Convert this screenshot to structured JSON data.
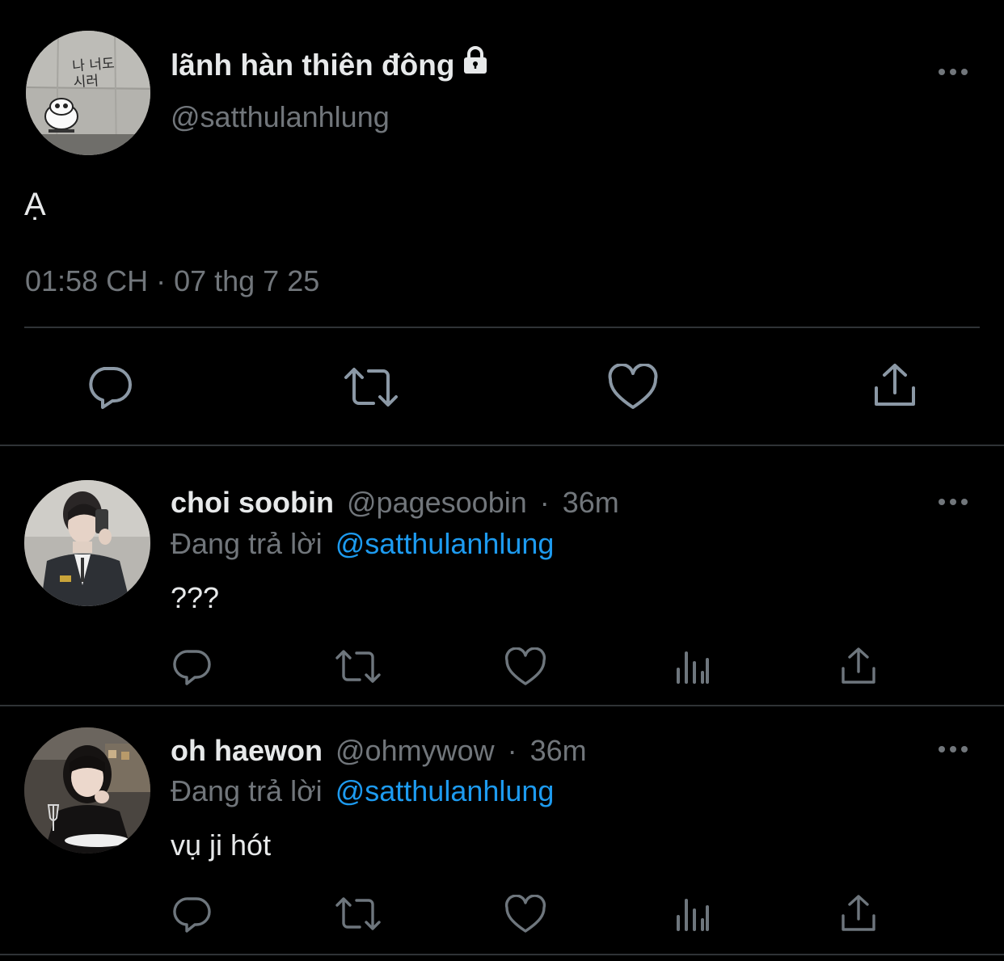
{
  "main_tweet": {
    "display_name": "lãnh hàn thiên đông",
    "handle": "@satthulanhlung",
    "text": "Ạ",
    "timestamp": "01:58 CH · 07 thg 7 25",
    "avatar_graffiti": "나 너도 시러",
    "icons": [
      "reply-icon",
      "retweet-icon",
      "like-icon",
      "share-icon"
    ]
  },
  "replies": [
    {
      "display_name": "choi soobin",
      "handle": "@pagesoobin",
      "dot": "·",
      "time": "36m",
      "replying_prefix": "Đang trả lời",
      "replying_to": "@satthulanhlung",
      "text": "???"
    },
    {
      "display_name": "oh haewon",
      "handle": "@ohmywow",
      "dot": "·",
      "time": "36m",
      "replying_prefix": "Đang trả lời",
      "replying_to": "@satthulanhlung",
      "text": "vụ ji hót"
    }
  ],
  "colors": {
    "background": "#000000",
    "text": "#e7e9ea",
    "secondary": "#71767b",
    "link": "#1d9bf0",
    "divider": "#2f3336"
  }
}
